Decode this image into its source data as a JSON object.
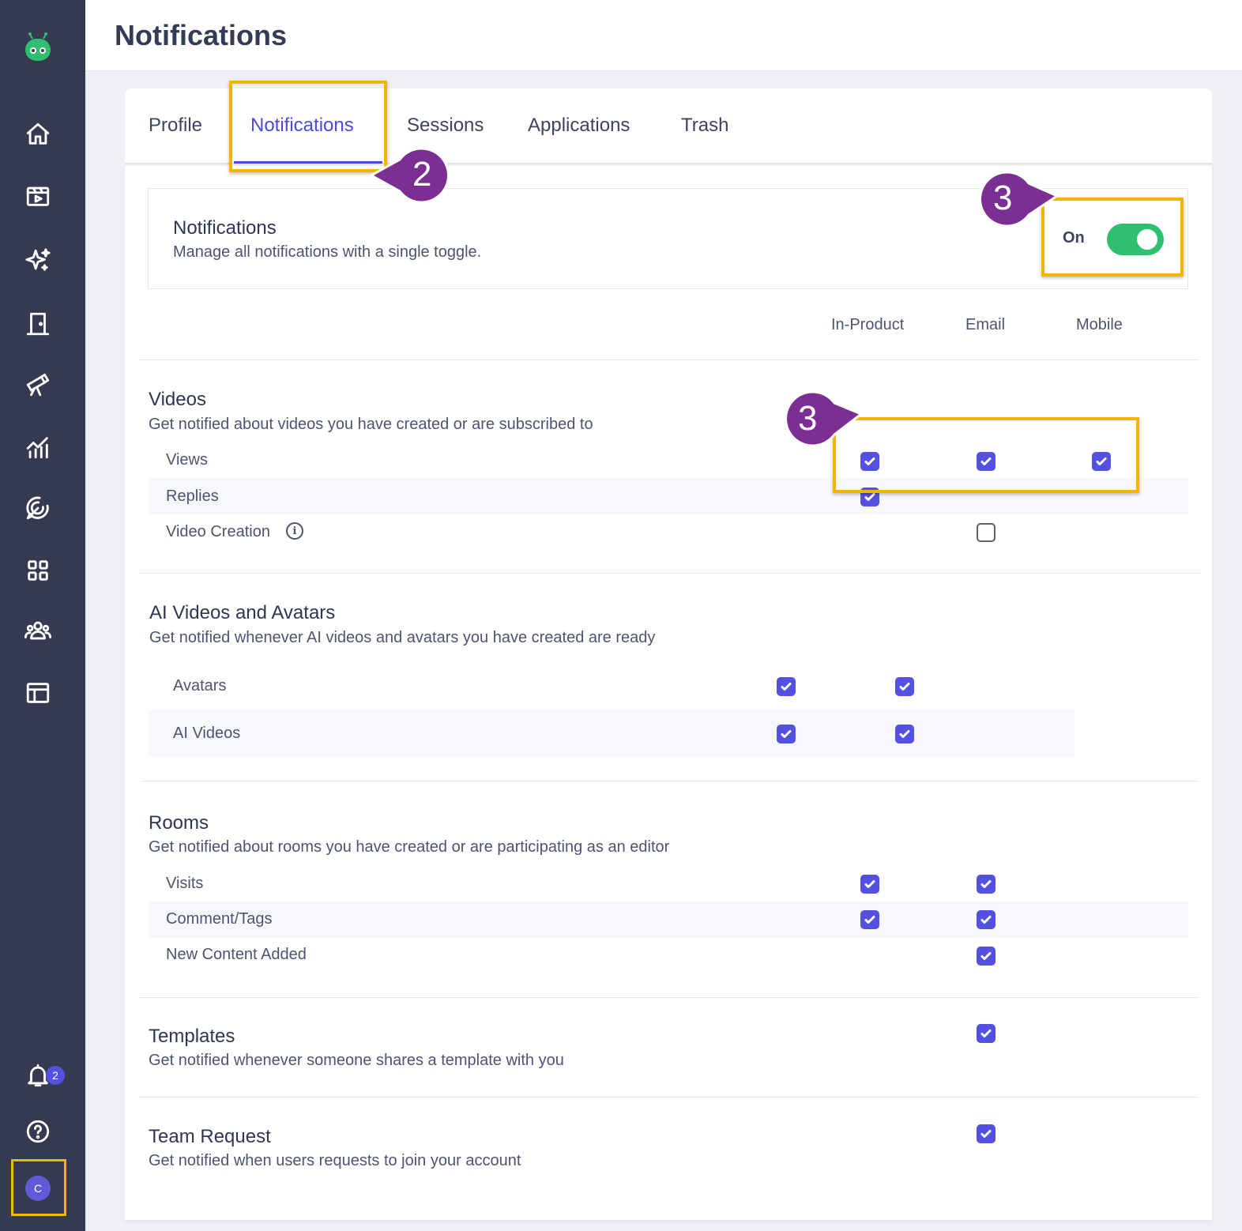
{
  "app": {
    "avatar_initial": "C",
    "notification_count": "2"
  },
  "header": {
    "title": "Notifications"
  },
  "tabs": [
    {
      "label": "Profile"
    },
    {
      "label": "Notifications"
    },
    {
      "label": "Sessions"
    },
    {
      "label": "Applications"
    },
    {
      "label": "Trash"
    }
  ],
  "master": {
    "title": "Notifications",
    "description": "Manage all notifications with a single toggle.",
    "state_label": "On",
    "enabled": true
  },
  "columns": [
    "In-Product",
    "Email",
    "Mobile"
  ],
  "sections": {
    "videos": {
      "title": "Videos",
      "description": "Get notified about videos you have created or are subscribed to",
      "rows": [
        {
          "label": "Views",
          "in_product": true,
          "email": true,
          "mobile": true
        },
        {
          "label": "Replies",
          "in_product": true
        },
        {
          "label": "Video Creation",
          "email": false
        }
      ]
    },
    "ai": {
      "title": "AI Videos and Avatars",
      "description": "Get notified whenever AI videos and avatars you have created are ready",
      "rows": [
        {
          "label": "Avatars",
          "in_product": true,
          "email": true
        },
        {
          "label": "AI Videos",
          "in_product": true,
          "email": true
        }
      ]
    },
    "rooms": {
      "title": "Rooms",
      "description": "Get notified about rooms you have created or are participating as an editor",
      "rows": [
        {
          "label": "Visits",
          "in_product": true,
          "email": true
        },
        {
          "label": "Comment/Tags",
          "in_product": true,
          "email": true
        },
        {
          "label": "New Content Added",
          "email": true
        }
      ]
    },
    "templates": {
      "title": "Templates",
      "description": "Get notified whenever someone shares a template with you",
      "email": true
    },
    "team": {
      "title": "Team Request",
      "description": "Get notified when users requests to join your account",
      "email": true
    }
  },
  "annotations": {
    "step_tab": "2",
    "step_toggle": "3",
    "step_checkboxes": "3",
    "highlight_color": "#f5b400",
    "callout_color": "#7b2f92"
  },
  "colors": {
    "accent": "#5450e0",
    "toggle_on": "#2fbf71",
    "sidebar": "#353a51"
  },
  "icons": [
    "logo-icon",
    "home-icon",
    "video-library-icon",
    "sparkles-icon",
    "door-icon",
    "telescope-icon",
    "analytics-icon",
    "target-icon",
    "apps-grid-icon",
    "team-icon",
    "layout-icon",
    "bell-icon",
    "help-icon",
    "info-icon",
    "check-icon"
  ]
}
